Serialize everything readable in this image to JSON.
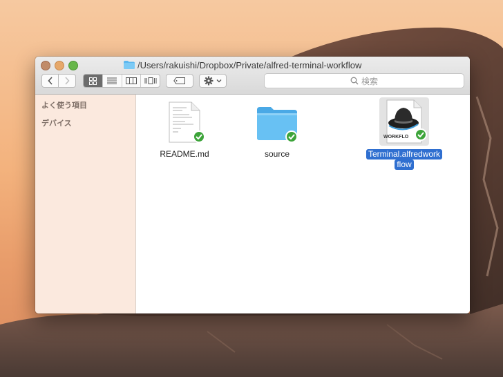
{
  "window": {
    "title_path": "/Users/rakuishi/Dropbox/Private/alfred-terminal-workflow"
  },
  "toolbar": {
    "back_label": "<",
    "forward_label": ">",
    "search_placeholder": "検索",
    "view_modes": [
      "icon-view",
      "list-view",
      "column-view",
      "coverflow-view"
    ],
    "active_view": "icon-view"
  },
  "sidebar": {
    "sections": [
      {
        "label": "よく使う項目"
      },
      {
        "label": "デバイス"
      }
    ]
  },
  "files": [
    {
      "name": "README.md",
      "kind": "document-icon",
      "synced": true,
      "selected": false
    },
    {
      "name": "source",
      "kind": "folder-icon",
      "synced": true,
      "selected": false
    },
    {
      "name_line1": "Terminal.alfredwork",
      "name_line2": "flow",
      "kind": "workflow-icon",
      "icon_text": "WORKFLO",
      "synced": true,
      "selected": true
    }
  ],
  "colors": {
    "selection": "#2f6fd0",
    "sync_badge": "#3da43a",
    "folder": "#5cb8ef",
    "sidebar_bg": "#fbe9de"
  }
}
